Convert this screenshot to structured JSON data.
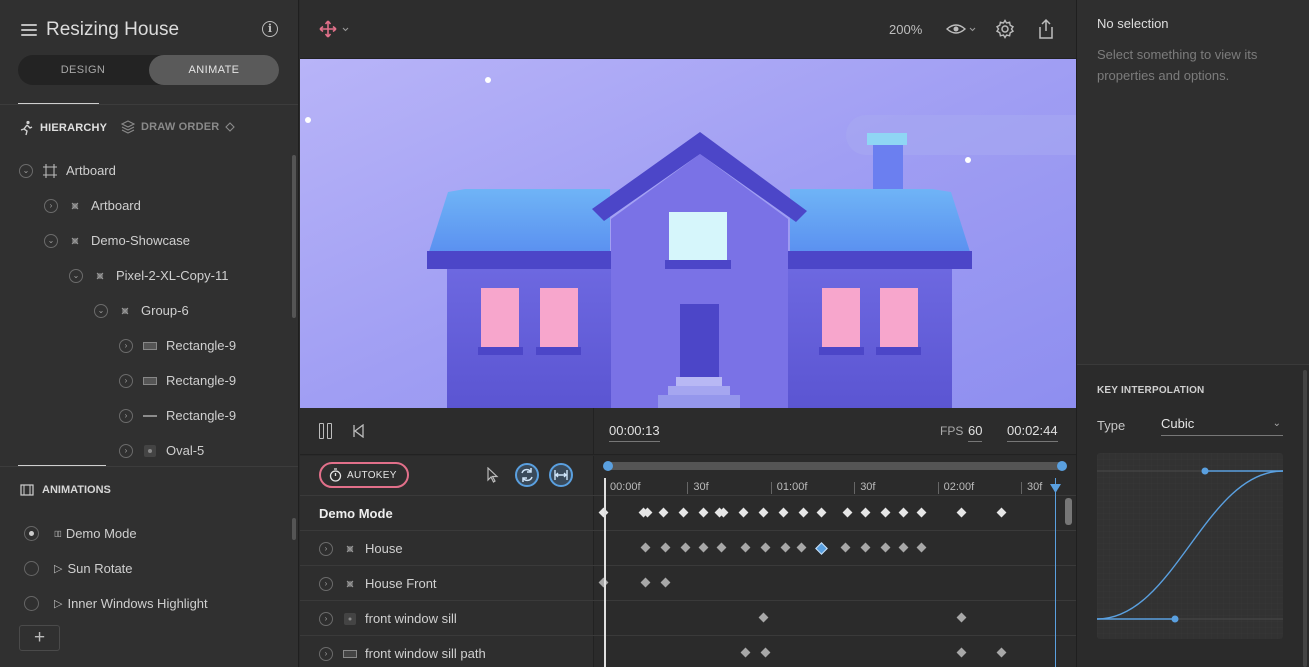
{
  "app": {
    "file_title": "Resizing House"
  },
  "mode_toggle": {
    "design": "DESIGN",
    "animate": "ANIMATE",
    "active": "ANIMATE"
  },
  "hierarchy_tabs": {
    "hierarchy": "HIERARCHY",
    "draw_order": "DRAW ORDER"
  },
  "hierarchy": [
    {
      "label": "Artboard",
      "depth": 0,
      "icon": "artboard-icon",
      "expander": "expanded"
    },
    {
      "label": "Artboard",
      "depth": 1,
      "icon": "node-icon",
      "expander": "collapsed"
    },
    {
      "label": "Demo-Showcase",
      "depth": 1,
      "icon": "node-icon",
      "expander": "expanded"
    },
    {
      "label": "Pixel-2-XL-Copy-11",
      "depth": 2,
      "icon": "node-icon",
      "expander": "expanded"
    },
    {
      "label": "Group-6",
      "depth": 3,
      "icon": "node-icon",
      "expander": "expanded"
    },
    {
      "label": "Rectangle-9",
      "depth": 4,
      "icon": "rectangle-icon",
      "expander": "collapsed"
    },
    {
      "label": "Rectangle-9",
      "depth": 4,
      "icon": "rectangle-icon",
      "expander": "collapsed"
    },
    {
      "label": "Rectangle-9",
      "depth": 4,
      "icon": "line-icon",
      "expander": "collapsed"
    },
    {
      "label": "Oval-5",
      "depth": 4,
      "icon": "ellipse-icon",
      "expander": "collapsed"
    }
  ],
  "animations": {
    "header": "ANIMATIONS",
    "items": [
      {
        "label": "Demo Mode",
        "selected": true,
        "icon": "pause-icon"
      },
      {
        "label": "Sun Rotate",
        "selected": false,
        "icon": "play-icon"
      },
      {
        "label": "Inner Windows Highlight",
        "selected": false,
        "icon": "play-icon"
      }
    ]
  },
  "toolbar": {
    "zoom": "200%"
  },
  "playback": {
    "current_time": "00:00:13",
    "fps_label": "FPS",
    "fps": "60",
    "duration": "00:02:44"
  },
  "timeline": {
    "autokey": "AUTOKEY",
    "ruler": [
      "00:00f",
      "30f",
      "01:00f",
      "30f",
      "02:00f",
      "30f"
    ],
    "rows": [
      {
        "label": "Demo Mode",
        "kind": "animation",
        "keys": [
          0,
          40,
          44,
          60,
          80,
          100,
          116,
          120,
          140,
          160,
          180,
          200,
          218,
          244,
          262,
          282,
          300,
          318,
          358,
          398
        ]
      },
      {
        "label": "House",
        "kind": "node",
        "icon": "node-icon",
        "keys": [
          42,
          62,
          82,
          100,
          118,
          142,
          162,
          182,
          198,
          217,
          242,
          262,
          282,
          300,
          318
        ]
      },
      {
        "label": "House Front",
        "kind": "node",
        "icon": "node-icon",
        "keys": [
          0,
          42,
          62
        ]
      },
      {
        "label": "front window sill",
        "kind": "node",
        "icon": "shape-icon",
        "keys": [
          160,
          358
        ]
      },
      {
        "label": "front window sill path",
        "kind": "node",
        "icon": "path-icon",
        "keys": [
          142,
          162,
          358,
          398
        ]
      }
    ]
  },
  "inspector": {
    "title": "No selection",
    "hint": "Select something to view its properties and options.",
    "key_interpolation": {
      "title": "KEY INTERPOLATION",
      "type_label": "Type",
      "type_value": "Cubic"
    }
  },
  "colors": {
    "accent": "#e2708a",
    "timeline_blue": "#5aa0e0",
    "sky_top": "#a9a8f7",
    "house_roof": "#6fa8f4",
    "window_pink": "#f7a6cc"
  }
}
